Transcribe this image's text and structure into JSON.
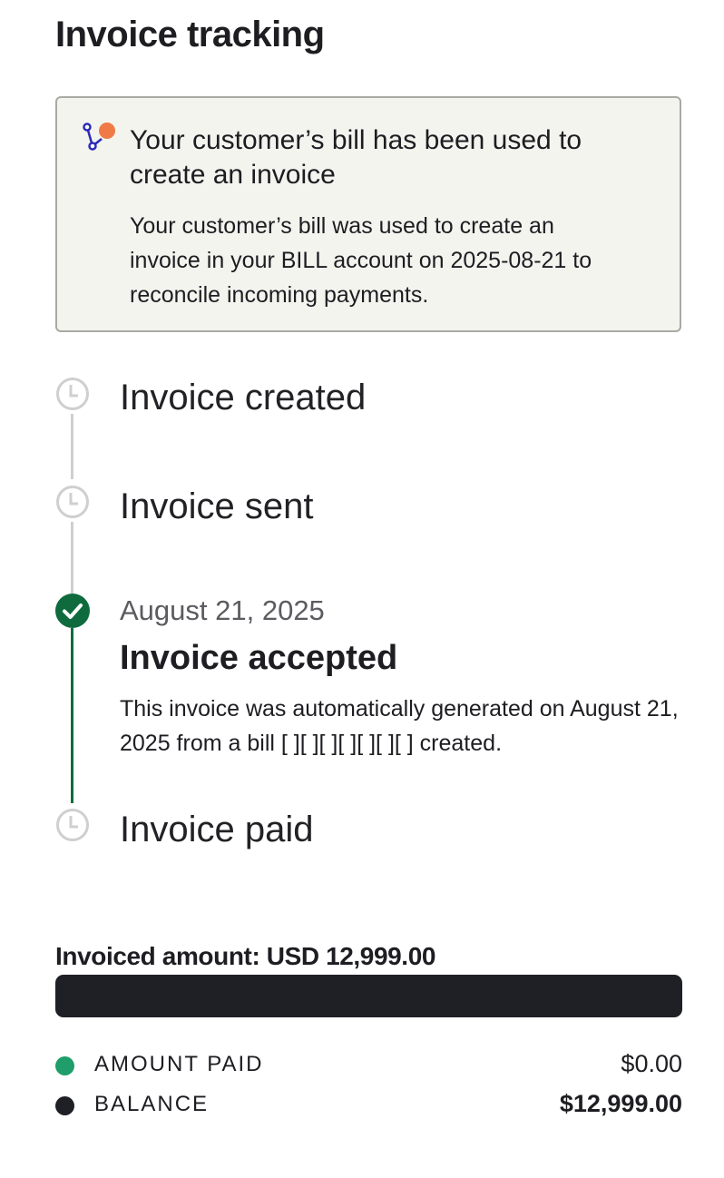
{
  "page": {
    "title": "Invoice tracking"
  },
  "notice": {
    "icon": "branch-merge-icon",
    "title": "Your customer’s bill has been used to create an invoice",
    "body": "Your customer’s bill was used to create an invoice in your BILL account on 2025-08-21 to reconcile incoming payments.",
    "colors": {
      "accent_dot": "#f07a47",
      "icon_stroke": "#2b2bb8"
    }
  },
  "timeline": {
    "steps": [
      {
        "label": "Invoice created",
        "status": "pending",
        "icon": "clock-icon"
      },
      {
        "label": "Invoice sent",
        "status": "pending",
        "icon": "clock-icon"
      },
      {
        "date": "August 21, 2025",
        "label": "Invoice accepted",
        "status": "complete",
        "icon": "check-circle-icon",
        "description": "This invoice was automatically generated on August 21, 2025 from a bill [ ][ ][ ][ ][ ][ ][ ] created."
      },
      {
        "label": "Invoice paid",
        "status": "pending",
        "icon": "clock-icon"
      }
    ],
    "colors": {
      "complete": "#0f6b3e",
      "pending": "#cfcfcf"
    }
  },
  "amount": {
    "title": "Invoiced amount: USD 12,999.00",
    "paid_fraction": 0,
    "legend": [
      {
        "label": "AMOUNT PAID",
        "value": "$0.00",
        "color": "#1f9d6b"
      },
      {
        "label": "BALANCE",
        "value": "$12,999.00",
        "color": "#1f1f26"
      }
    ]
  }
}
